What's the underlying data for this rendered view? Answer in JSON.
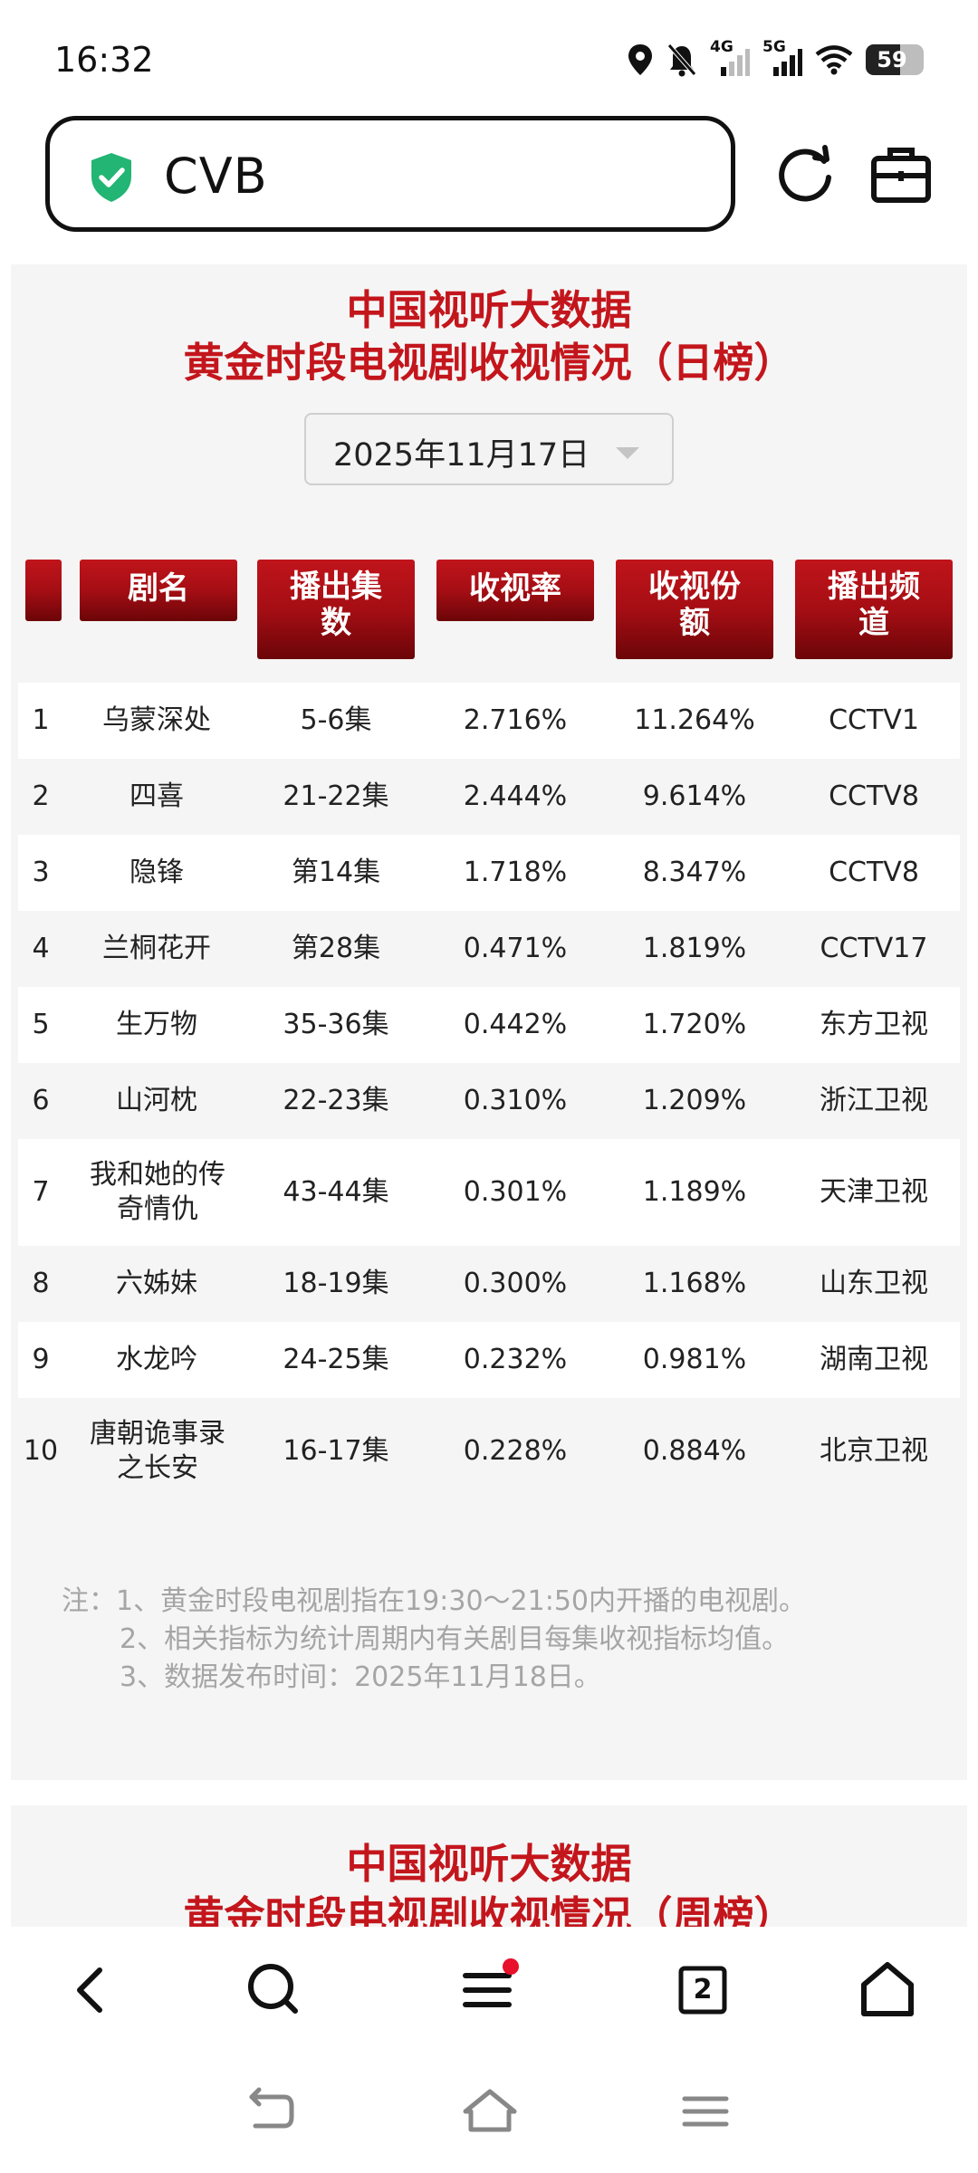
{
  "status_bar": {
    "time": "16:32",
    "network_1": "4G",
    "network_2": "5G",
    "battery": "59"
  },
  "browser": {
    "url": "CVB",
    "tab_count": "2"
  },
  "panel1": {
    "title_line1": "中国视听大数据",
    "title_line2": "黄金时段电视剧收视情况（日榜）",
    "date": "2025年11月17日",
    "headers": [
      "",
      "剧名",
      "播出集数",
      "收视率",
      "收视份额",
      "播出频道"
    ],
    "rows": [
      {
        "rank": "1",
        "name": "乌蒙深处",
        "episodes": "5-6集",
        "rating": "2.716%",
        "share": "11.264%",
        "channel": "CCTV1"
      },
      {
        "rank": "2",
        "name": "四喜",
        "episodes": "21-22集",
        "rating": "2.444%",
        "share": "9.614%",
        "channel": "CCTV8"
      },
      {
        "rank": "3",
        "name": "隐锋",
        "episodes": "第14集",
        "rating": "1.718%",
        "share": "8.347%",
        "channel": "CCTV8"
      },
      {
        "rank": "4",
        "name": "兰桐花开",
        "episodes": "第28集",
        "rating": "0.471%",
        "share": "1.819%",
        "channel": "CCTV17"
      },
      {
        "rank": "5",
        "name": "生万物",
        "episodes": "35-36集",
        "rating": "0.442%",
        "share": "1.720%",
        "channel": "东方卫视"
      },
      {
        "rank": "6",
        "name": "山河枕",
        "episodes": "22-23集",
        "rating": "0.310%",
        "share": "1.209%",
        "channel": "浙江卫视"
      },
      {
        "rank": "7",
        "name": "我和她的传奇情仇",
        "episodes": "43-44集",
        "rating": "0.301%",
        "share": "1.189%",
        "channel": "天津卫视"
      },
      {
        "rank": "8",
        "name": "六姊妹",
        "episodes": "18-19集",
        "rating": "0.300%",
        "share": "1.168%",
        "channel": "山东卫视"
      },
      {
        "rank": "9",
        "name": "水龙吟",
        "episodes": "24-25集",
        "rating": "0.232%",
        "share": "0.981%",
        "channel": "湖南卫视"
      },
      {
        "rank": "10",
        "name": "唐朝诡事录之长安",
        "episodes": "16-17集",
        "rating": "0.228%",
        "share": "0.884%",
        "channel": "北京卫视"
      }
    ],
    "notes": [
      "注：1、黄金时段电视剧指在19:30～21:50内开播的电视剧。",
      "2、相关指标为统计周期内有关剧目每集收视指标均值。",
      "3、数据发布时间：2025年11月18日。"
    ]
  },
  "panel2": {
    "title_line1": "中国视听大数据",
    "title_line2": "黄金时段电视剧收视情况（周榜）"
  },
  "colors": {
    "accent_red": "#c3161c",
    "header_dark_red": "#6b0508",
    "shield_green": "#22b573",
    "notification_dot": "#e8102a"
  },
  "icons": {
    "security": "shield-check-icon",
    "reload": "reload-icon",
    "tools": "toolbox-icon",
    "back": "back-icon",
    "search": "search-icon",
    "menu": "menu-icon",
    "tabs": "tabs-icon",
    "home": "home-icon"
  }
}
